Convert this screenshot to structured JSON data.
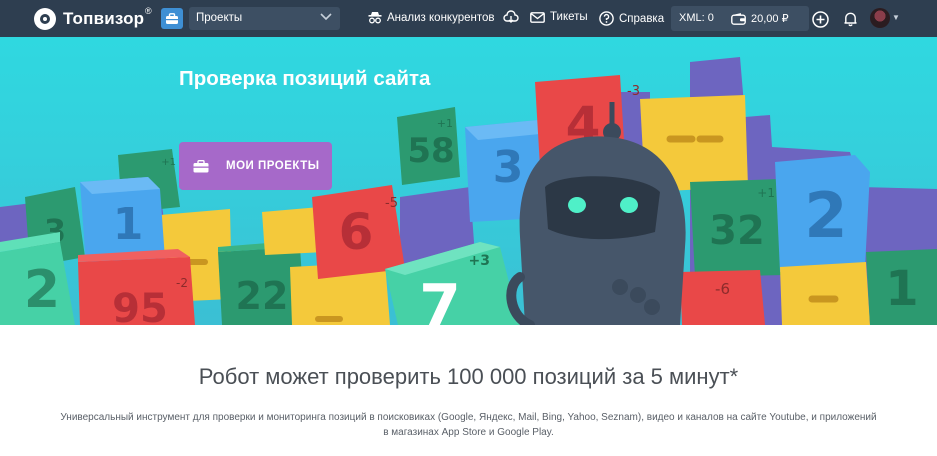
{
  "navbar": {
    "logo_text": "Топвизор",
    "registered_mark": "®",
    "projects_select": {
      "value": "Проекты"
    },
    "links": {
      "competitors": "Анализ конкурентов",
      "tickets": "Тикеты",
      "help": "Справка"
    },
    "balance": {
      "xml": "XML: 0",
      "money": "20,00 ₽"
    }
  },
  "hero": {
    "title": "Проверка позиций сайта",
    "button_label": "МОИ ПРОЕКТЫ",
    "blocks": {
      "b58": "58",
      "b58_delta": "+1",
      "b3": "3",
      "b4": "4",
      "b4_delta": "-3",
      "b1": "1",
      "b6": "6",
      "b6_delta": "-5",
      "b32": "32",
      "b32_delta": "+1",
      "b2r": "2",
      "b95": "95",
      "b95_delta": "-2",
      "b22": "22",
      "b7": "7",
      "b7_delta": "+3",
      "b6b_delta": "-6",
      "b2l": "2",
      "b3l": "3",
      "b1r": "1",
      "b1g_delta": "+1"
    }
  },
  "main": {
    "headline": "Робот может проверить 100 000 позиций за 5 минут*",
    "description": "Универсальный инструмент для проверки и мониторинга позиций в поисковиках (Google, Яндекс, Mail, Bing, Yahoo, Seznam), видео и каналов на сайте Youtube, и приложений в магазинах App Store и Google Play."
  },
  "colors": {
    "navbar": "#2e3e50",
    "hero_bg": "#2fd8e0",
    "button": "#a669c9",
    "block_red": "#e94848",
    "block_yellow": "#f4c93b",
    "block_blue": "#4aa6ee",
    "block_green": "#2c9a70",
    "block_mint": "#46d1a6",
    "block_purple": "#6d65c0"
  },
  "icons": [
    "logo-icon",
    "briefcase-icon",
    "chevron-down-icon",
    "spy-icon",
    "cloud-icon",
    "mail-icon",
    "question-icon",
    "wallet-icon",
    "plus-circle-icon",
    "bell-icon"
  ]
}
